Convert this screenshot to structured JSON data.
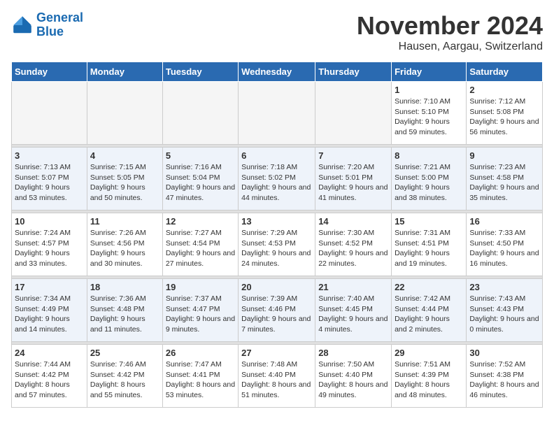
{
  "logo": {
    "line1": "General",
    "line2": "Blue"
  },
  "title": "November 2024",
  "location": "Hausen, Aargau, Switzerland",
  "weekdays": [
    "Sunday",
    "Monday",
    "Tuesday",
    "Wednesday",
    "Thursday",
    "Friday",
    "Saturday"
  ],
  "weeks": [
    {
      "days": [
        {
          "empty": true
        },
        {
          "empty": true
        },
        {
          "empty": true
        },
        {
          "empty": true
        },
        {
          "empty": true
        },
        {
          "num": "1",
          "sunrise": "7:10 AM",
          "sunset": "5:10 PM",
          "daylight": "9 hours and 59 minutes."
        },
        {
          "num": "2",
          "sunrise": "7:12 AM",
          "sunset": "5:08 PM",
          "daylight": "9 hours and 56 minutes."
        }
      ]
    },
    {
      "days": [
        {
          "num": "3",
          "sunrise": "7:13 AM",
          "sunset": "5:07 PM",
          "daylight": "9 hours and 53 minutes."
        },
        {
          "num": "4",
          "sunrise": "7:15 AM",
          "sunset": "5:05 PM",
          "daylight": "9 hours and 50 minutes."
        },
        {
          "num": "5",
          "sunrise": "7:16 AM",
          "sunset": "5:04 PM",
          "daylight": "9 hours and 47 minutes."
        },
        {
          "num": "6",
          "sunrise": "7:18 AM",
          "sunset": "5:02 PM",
          "daylight": "9 hours and 44 minutes."
        },
        {
          "num": "7",
          "sunrise": "7:20 AM",
          "sunset": "5:01 PM",
          "daylight": "9 hours and 41 minutes."
        },
        {
          "num": "8",
          "sunrise": "7:21 AM",
          "sunset": "5:00 PM",
          "daylight": "9 hours and 38 minutes."
        },
        {
          "num": "9",
          "sunrise": "7:23 AM",
          "sunset": "4:58 PM",
          "daylight": "9 hours and 35 minutes."
        }
      ]
    },
    {
      "days": [
        {
          "num": "10",
          "sunrise": "7:24 AM",
          "sunset": "4:57 PM",
          "daylight": "9 hours and 33 minutes."
        },
        {
          "num": "11",
          "sunrise": "7:26 AM",
          "sunset": "4:56 PM",
          "daylight": "9 hours and 30 minutes."
        },
        {
          "num": "12",
          "sunrise": "7:27 AM",
          "sunset": "4:54 PM",
          "daylight": "9 hours and 27 minutes."
        },
        {
          "num": "13",
          "sunrise": "7:29 AM",
          "sunset": "4:53 PM",
          "daylight": "9 hours and 24 minutes."
        },
        {
          "num": "14",
          "sunrise": "7:30 AM",
          "sunset": "4:52 PM",
          "daylight": "9 hours and 22 minutes."
        },
        {
          "num": "15",
          "sunrise": "7:31 AM",
          "sunset": "4:51 PM",
          "daylight": "9 hours and 19 minutes."
        },
        {
          "num": "16",
          "sunrise": "7:33 AM",
          "sunset": "4:50 PM",
          "daylight": "9 hours and 16 minutes."
        }
      ]
    },
    {
      "days": [
        {
          "num": "17",
          "sunrise": "7:34 AM",
          "sunset": "4:49 PM",
          "daylight": "9 hours and 14 minutes."
        },
        {
          "num": "18",
          "sunrise": "7:36 AM",
          "sunset": "4:48 PM",
          "daylight": "9 hours and 11 minutes."
        },
        {
          "num": "19",
          "sunrise": "7:37 AM",
          "sunset": "4:47 PM",
          "daylight": "9 hours and 9 minutes."
        },
        {
          "num": "20",
          "sunrise": "7:39 AM",
          "sunset": "4:46 PM",
          "daylight": "9 hours and 7 minutes."
        },
        {
          "num": "21",
          "sunrise": "7:40 AM",
          "sunset": "4:45 PM",
          "daylight": "9 hours and 4 minutes."
        },
        {
          "num": "22",
          "sunrise": "7:42 AM",
          "sunset": "4:44 PM",
          "daylight": "9 hours and 2 minutes."
        },
        {
          "num": "23",
          "sunrise": "7:43 AM",
          "sunset": "4:43 PM",
          "daylight": "9 hours and 0 minutes."
        }
      ]
    },
    {
      "days": [
        {
          "num": "24",
          "sunrise": "7:44 AM",
          "sunset": "4:42 PM",
          "daylight": "8 hours and 57 minutes."
        },
        {
          "num": "25",
          "sunrise": "7:46 AM",
          "sunset": "4:42 PM",
          "daylight": "8 hours and 55 minutes."
        },
        {
          "num": "26",
          "sunrise": "7:47 AM",
          "sunset": "4:41 PM",
          "daylight": "8 hours and 53 minutes."
        },
        {
          "num": "27",
          "sunrise": "7:48 AM",
          "sunset": "4:40 PM",
          "daylight": "8 hours and 51 minutes."
        },
        {
          "num": "28",
          "sunrise": "7:50 AM",
          "sunset": "4:40 PM",
          "daylight": "8 hours and 49 minutes."
        },
        {
          "num": "29",
          "sunrise": "7:51 AM",
          "sunset": "4:39 PM",
          "daylight": "8 hours and 48 minutes."
        },
        {
          "num": "30",
          "sunrise": "7:52 AM",
          "sunset": "4:38 PM",
          "daylight": "8 hours and 46 minutes."
        }
      ]
    }
  ]
}
